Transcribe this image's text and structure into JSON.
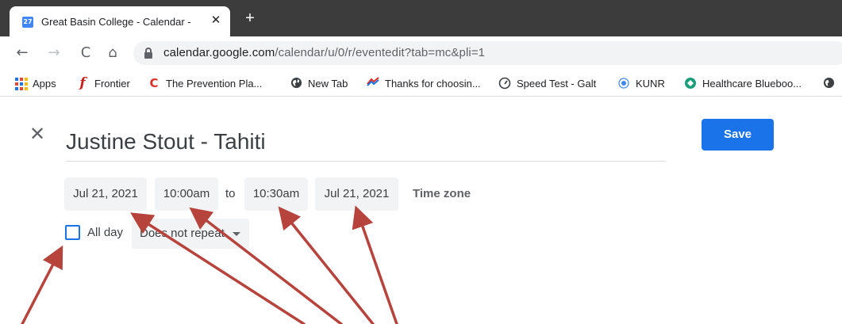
{
  "browser": {
    "tab": {
      "favicon_text": "27",
      "title": "Great Basin College - Calendar - ",
      "close_icon": "close-icon"
    },
    "new_tab_icon": "plus-icon",
    "nav": {
      "back_icon": "arrow-left-icon",
      "forward_icon": "arrow-right-icon",
      "reload_icon": "reload-icon",
      "home_icon": "home-icon"
    },
    "url_host": "calendar.google.com",
    "url_path": "/calendar/u/0/r/eventedit?tab=mc&pli=1",
    "bookmarks": [
      {
        "label": "Apps",
        "icon": "apps-grid-icon"
      },
      {
        "label": "Frontier",
        "icon": "frontier-icon",
        "color": "#c5221f"
      },
      {
        "label": "The Prevention Pla...",
        "icon": "prevention-plan-icon",
        "color": "#d93025"
      },
      {
        "label": "New Tab",
        "icon": "globe-icon",
        "color": "#3c4043"
      },
      {
        "label": "Thanks for choosin...",
        "icon": "bank-logo-icon",
        "color": "#d93025"
      },
      {
        "label": "Speed Test - Galt",
        "icon": "speedometer-icon",
        "color": "#3c4043"
      },
      {
        "label": "KUNR",
        "icon": "radio-icon",
        "color": "#4285f4"
      },
      {
        "label": "Healthcare Blueboo...",
        "icon": "healthcare-icon",
        "color": "#1a9e7a"
      },
      {
        "label": "",
        "icon": "globe-icon",
        "color": "#3c4043"
      }
    ]
  },
  "event": {
    "close_icon": "close-icon",
    "title": "Justine Stout - Tahiti",
    "save_label": "Save",
    "start_date": "Jul 21, 2021",
    "start_time": "10:00am",
    "to_label": "to",
    "end_time": "10:30am",
    "end_date": "Jul 21, 2021",
    "timezone_label": "Time zone",
    "all_day_label": "All day",
    "all_day_checked": false,
    "repeat_value": "Does not repeat"
  },
  "colors": {
    "accent": "#1a73e8",
    "annotation_arrow": "#b7433d",
    "tabstrip": "#3c3c3c",
    "chip_bg": "#f1f3f4"
  }
}
